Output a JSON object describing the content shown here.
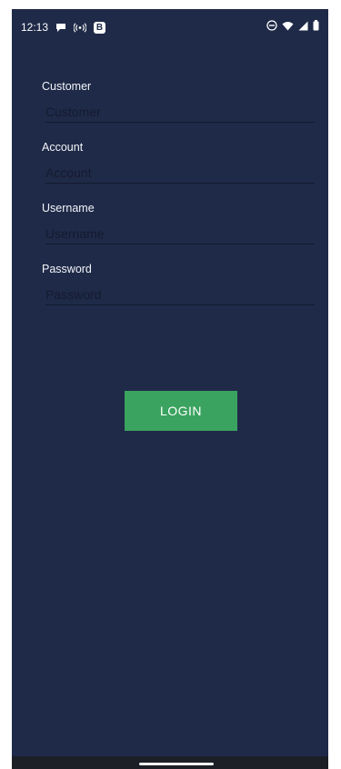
{
  "status_bar": {
    "time": "12:13",
    "badge": "B",
    "left_icons": [
      "chat-bubble-icon",
      "hotspot-icon",
      "b-badge-icon"
    ],
    "right_icons": [
      "do-not-disturb-icon",
      "wifi-icon",
      "signal-icon",
      "battery-icon"
    ]
  },
  "form": {
    "customer": {
      "label": "Customer",
      "placeholder": "Customer",
      "value": ""
    },
    "account": {
      "label": "Account",
      "placeholder": "Account",
      "value": ""
    },
    "username": {
      "label": "Username",
      "placeholder": "Username",
      "value": ""
    },
    "password": {
      "label": "Password",
      "placeholder": "Password",
      "value": ""
    }
  },
  "login_button": {
    "label": "LOGIN"
  },
  "colors": {
    "background": "#1f2a48",
    "button": "#3aa35f",
    "nav_bar": "#1c1f26"
  }
}
